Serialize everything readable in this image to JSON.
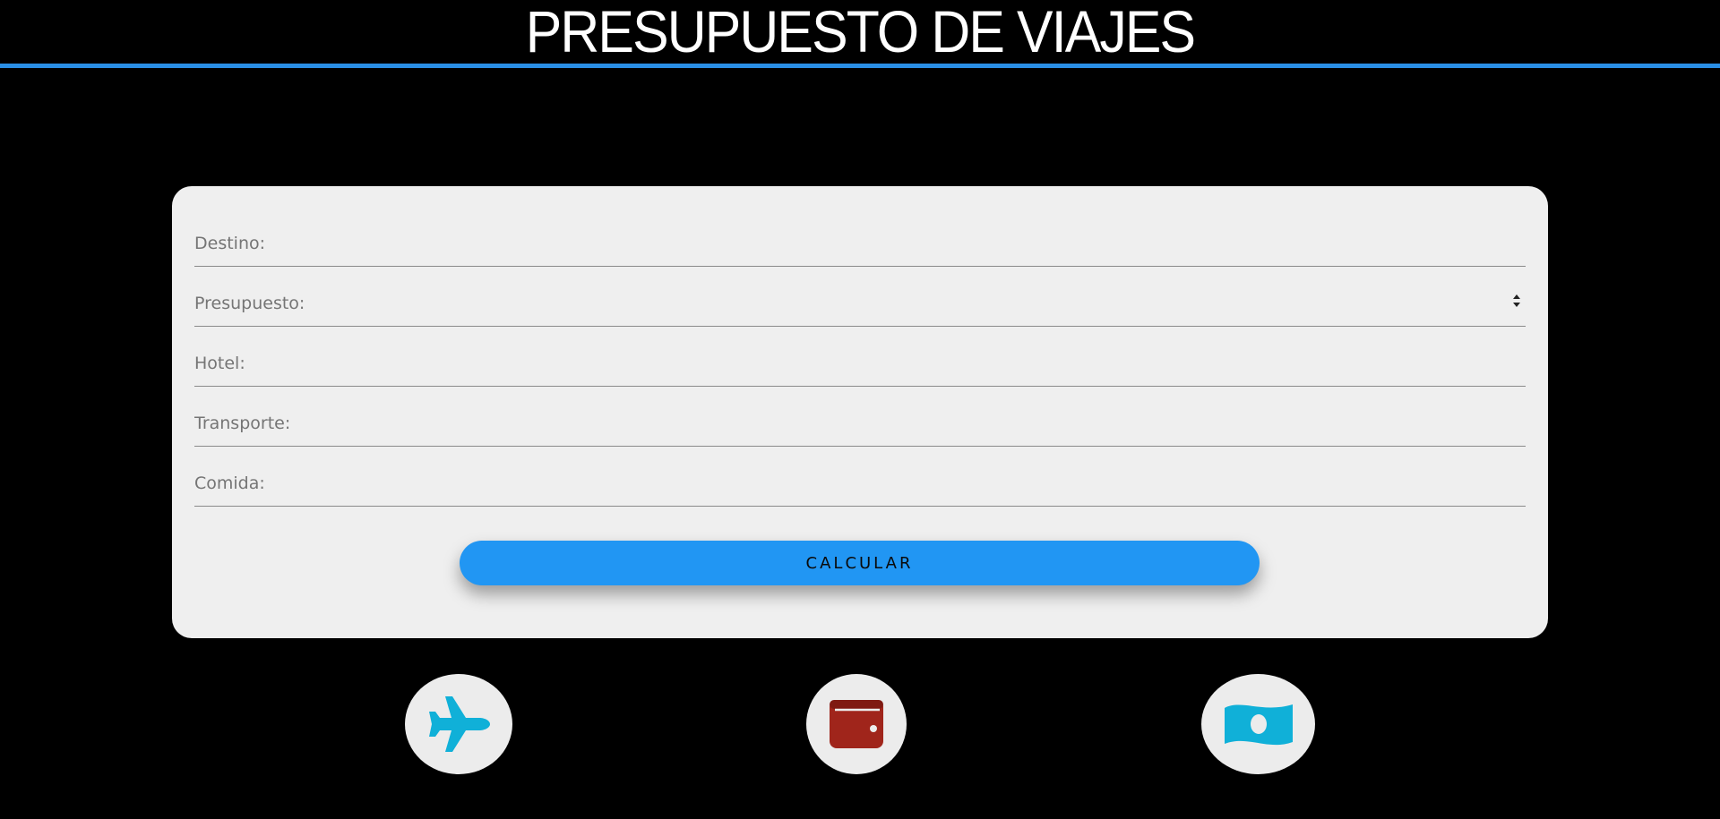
{
  "header": {
    "title": "PRESUPUESTO DE VIAJES"
  },
  "form": {
    "fields": [
      {
        "name": "destino",
        "placeholder": "Destino:",
        "value": ""
      },
      {
        "name": "presupuesto",
        "placeholder": "Presupuesto:",
        "value": ""
      },
      {
        "name": "hotel",
        "placeholder": "Hotel:",
        "value": ""
      },
      {
        "name": "transporte",
        "placeholder": "Transporte:",
        "value": ""
      },
      {
        "name": "comida",
        "placeholder": "Comida:",
        "value": ""
      }
    ],
    "calculate_label": "CALCULAR"
  },
  "icons": [
    {
      "name": "airplane-icon",
      "color": "#10b0d8"
    },
    {
      "name": "wallet-icon",
      "color": "#a0251b"
    },
    {
      "name": "money-bill-icon",
      "color": "#10b0d8"
    }
  ],
  "colors": {
    "background": "#000000",
    "accent": "#2196f3",
    "header_rule": "#2a8fe6",
    "card": "#efefef"
  }
}
